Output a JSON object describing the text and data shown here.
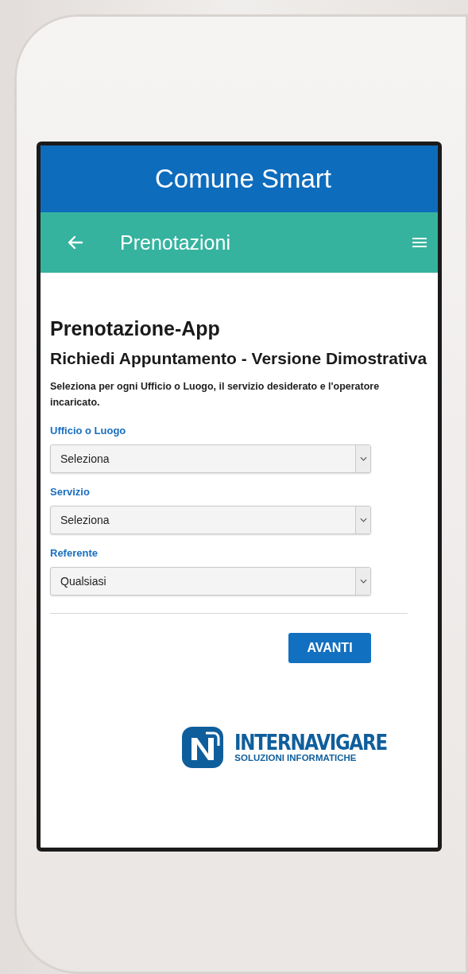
{
  "app_bar": {
    "title": "Comune Smart"
  },
  "toolbar": {
    "title": "Prenotazioni"
  },
  "form": {
    "title": "Prenotazione-App",
    "subtitle": "Richiedi Appuntamento - Versione Dimostrativa",
    "description": "Seleziona per ogni Ufficio o Luogo, il servizio desiderato e l'operatore incaricato.",
    "fields": [
      {
        "label": "Ufficio o Luogo",
        "value": "Seleziona"
      },
      {
        "label": "Servizio",
        "value": "Seleziona"
      },
      {
        "label": "Referente",
        "value": "Qualsiasi"
      }
    ],
    "button": "AVANTI"
  },
  "logo": {
    "name": "INTERNAVIGARE",
    "tagline": "SOLUZIONI INFORMATICHE"
  }
}
